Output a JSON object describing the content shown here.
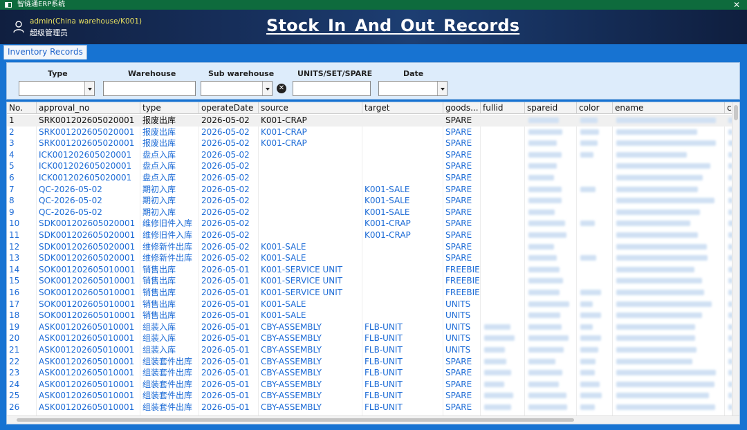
{
  "window": {
    "title": "智链通ERP系统",
    "close_symbol": "✕"
  },
  "header": {
    "user_line1": "admin(China warehouse/K001)",
    "user_line2": "超级管理员",
    "page_title": "Stock  In And Out Records"
  },
  "tabs": [
    {
      "label": "Inventory Records"
    }
  ],
  "filters": {
    "type_label": "Type",
    "warehouse_label": "Warehouse",
    "subwarehouse_label": "Sub warehouse",
    "units_label": "UNITS/SET/SPARE",
    "date_label": "Date",
    "clear_symbol": "✕"
  },
  "table": {
    "columns": [
      "No.",
      "approval_no",
      "type",
      "operateDate",
      "source",
      "target",
      "goods...",
      "fullid",
      "spareid",
      "color",
      "ename",
      "cr"
    ],
    "rows": [
      [
        "1",
        "SRK001202605020001",
        "报废出库",
        "2026-05-02",
        "K001-CRAP",
        "",
        "SPARE"
      ],
      [
        "2",
        "SRK001202605020001",
        "报废出库",
        "2026-05-02",
        "K001-CRAP",
        "",
        "SPARE"
      ],
      [
        "3",
        "SRK001202605020001",
        "报废出库",
        "2026-05-02",
        "K001-CRAP",
        "",
        "SPARE"
      ],
      [
        "4",
        "ICK001202605020001",
        "盘点入库",
        "2026-05-02",
        "",
        "",
        "SPARE"
      ],
      [
        "5",
        "ICK001202605020001",
        "盘点入库",
        "2026-05-02",
        "",
        "",
        "SPARE"
      ],
      [
        "6",
        "ICK001202605020001",
        "盘点入库",
        "2026-05-02",
        "",
        "",
        "SPARE"
      ],
      [
        "7",
        "QC-2026-05-02",
        "期初入库",
        "2026-05-02",
        "",
        "K001-SALE",
        "SPARE"
      ],
      [
        "8",
        "QC-2026-05-02",
        "期初入库",
        "2026-05-02",
        "",
        "K001-SALE",
        "SPARE"
      ],
      [
        "9",
        "QC-2026-05-02",
        "期初入库",
        "2026-05-02",
        "",
        "K001-SALE",
        "SPARE"
      ],
      [
        "10",
        "SDK001202605020001",
        "维修旧件入库",
        "2026-05-02",
        "",
        "K001-CRAP",
        "SPARE"
      ],
      [
        "11",
        "SDK001202605020001",
        "维修旧件入库",
        "2026-05-02",
        "",
        "K001-CRAP",
        "SPARE"
      ],
      [
        "12",
        "SDK001202605020001",
        "维修新件出库",
        "2026-05-02",
        "K001-SALE",
        "",
        "SPARE"
      ],
      [
        "13",
        "SDK001202605020001",
        "维修新件出库",
        "2026-05-02",
        "K001-SALE",
        "",
        "SPARE"
      ],
      [
        "14",
        "SOK001202605010001",
        "销售出库",
        "2026-05-01",
        "K001-SERVICE UNIT",
        "",
        "FREEBIE"
      ],
      [
        "15",
        "SOK001202605010001",
        "销售出库",
        "2026-05-01",
        "K001-SERVICE UNIT",
        "",
        "FREEBIE"
      ],
      [
        "16",
        "SOK001202605010001",
        "销售出库",
        "2026-05-01",
        "K001-SERVICE UNIT",
        "",
        "FREEBIE"
      ],
      [
        "17",
        "SOK001202605010001",
        "销售出库",
        "2026-05-01",
        "K001-SALE",
        "",
        "UNITS"
      ],
      [
        "18",
        "SOK001202605010001",
        "销售出库",
        "2026-05-01",
        "K001-SALE",
        "",
        "UNITS"
      ],
      [
        "19",
        "ASK001202605010001",
        "组装入库",
        "2026-05-01",
        "CBY-ASSEMBLY",
        "FLB-UNIT",
        "UNITS"
      ],
      [
        "20",
        "ASK001202605010001",
        "组装入库",
        "2026-05-01",
        "CBY-ASSEMBLY",
        "FLB-UNIT",
        "UNITS"
      ],
      [
        "21",
        "ASK001202605010001",
        "组装入库",
        "2026-05-01",
        "CBY-ASSEMBLY",
        "FLB-UNIT",
        "UNITS"
      ],
      [
        "22",
        "ASK001202605010001",
        "组装套件出库",
        "2026-05-01",
        "CBY-ASSEMBLY",
        "FLB-UNIT",
        "SPARE"
      ],
      [
        "23",
        "ASK001202605010001",
        "组装套件出库",
        "2026-05-01",
        "CBY-ASSEMBLY",
        "FLB-UNIT",
        "SPARE"
      ],
      [
        "24",
        "ASK001202605010001",
        "组装套件出库",
        "2026-05-01",
        "CBY-ASSEMBLY",
        "FLB-UNIT",
        "SPARE"
      ],
      [
        "25",
        "ASK001202605010001",
        "组装套件出库",
        "2026-05-01",
        "CBY-ASSEMBLY",
        "FLB-UNIT",
        "SPARE"
      ],
      [
        "26",
        "ASK001202605010001",
        "组装套件出库",
        "2026-05-01",
        "CBY-ASSEMBLY",
        "FLB-UNIT",
        "SPARE"
      ]
    ]
  },
  "colors": {
    "title_bar": "#0e6b3d",
    "header_bg": "#17305d",
    "accent_blue": "#1773d2",
    "row_text": "#1c6bd6",
    "user_text": "#e8e060"
  }
}
